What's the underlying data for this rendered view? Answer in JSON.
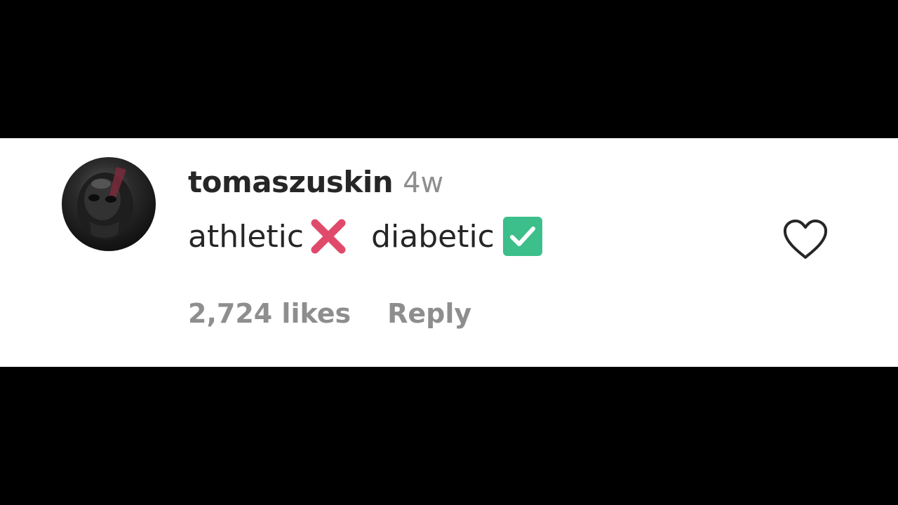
{
  "comment": {
    "username": "tomaszuskin",
    "timestamp": "4w",
    "text_part1": "athletic",
    "text_part2": "diabetic",
    "emoji_cross": "cross-mark-emoji",
    "emoji_check": "check-box-emoji",
    "likes_label": "2,724 likes",
    "reply_label": "Reply"
  },
  "icons": {
    "like": "heart-icon",
    "avatar": "avatar"
  },
  "colors": {
    "cross": "#e04a6a",
    "check_box": "#3cbf8a",
    "username": "#262626",
    "muted": "#8e8e8e"
  }
}
